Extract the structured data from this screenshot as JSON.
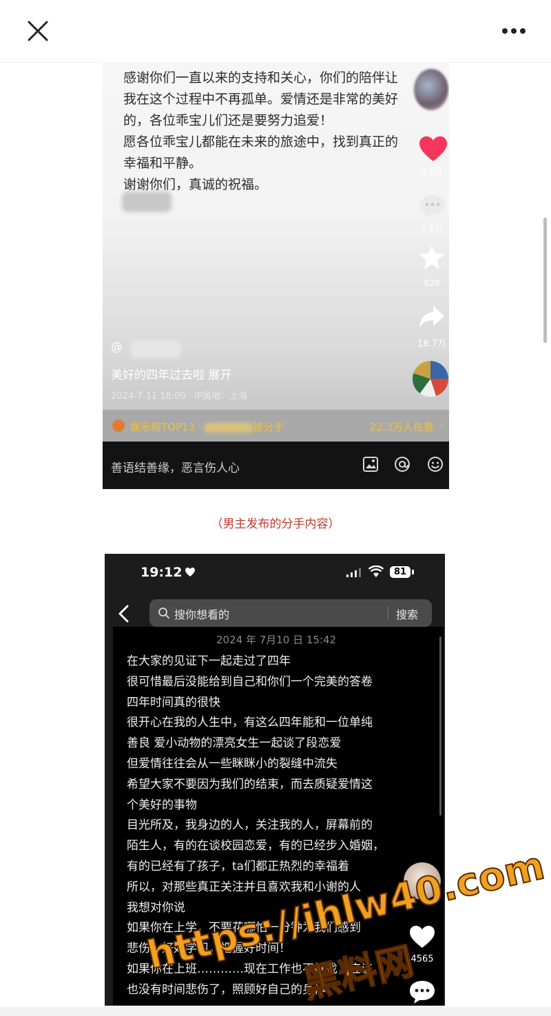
{
  "shot1": {
    "text_lines": "感谢你们一直以来的支持和关心，你们的陪伴让\n我在这个过程中不再孤单。爱情还是非常的美好\n的，各位乖宝儿们还是要努力追爱！\n愿各位乖宝儿都能在未来的旅途中，找到真正的\n幸福和平静。\n谢谢你们，真诚的祝福。",
    "like_count": "4.6万",
    "comment_count": "1.1万",
    "favorite_count": "828",
    "share_count": "18.7万",
    "author_prefix": "@",
    "caption": "美好的四年过去啦  展开",
    "meta": "2024-7-11 18:09 · IP属地：上海",
    "rank_label": "娱乐榜TOP13 · ",
    "rank_suffix": "被分手",
    "viewers": "22.3万人在看",
    "input_placeholder": "善语结善缘，恶言伤人心"
  },
  "caption_red": "（男主发布的分手内容）",
  "shot2": {
    "status_time": "19:12",
    "battery": "81",
    "search_placeholder": "搜你想看的",
    "search_button": "搜索",
    "note_date": "2024 年 7月10 日 15:42",
    "note_lines": "在大家的见证下一起走过了四年\n很可惜最后没能给到自己和你们一个完美的答卷\n四年时间真的很快\n很开心在我的人生中，有这么四年能和一位单纯\n善良 爱小动物的漂亮女生一起谈了段恋爱\n但爱情往往会从一些眯眯小的裂缝中流失\n希望大家不要因为我们的结束，而去质疑爱情这\n个美好的事物\n目光所及，我身边的人，关注我的人，屏幕前的\n陌生人，有的在谈校园恋爱，有的已经步入婚姻，\n有的已经有了孩子，ta们都正热烈的幸福着\n所以，对那些真正关注并且喜欢我和小谢的人\n我想对你说\n如果你在上学，不要花哪怕一分钟为我们感到\n悲伤，好好学习，把握好时间！\n如果你在上班…………现在工作也不好找，应该\n也没有时间悲伤了，照顾好自己的身体",
    "like_count": "4565"
  },
  "watermark": {
    "url": "https://ihlw40.com",
    "name": "黑料网"
  },
  "colors": {
    "heart": "#f5365c",
    "rank_text": "#f1c232",
    "caption_red": "#c0392b",
    "watermark": "#f0a020"
  }
}
